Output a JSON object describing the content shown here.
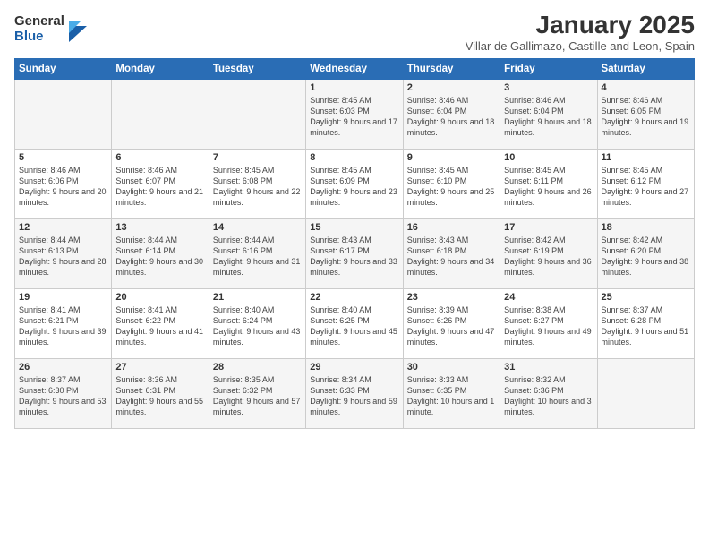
{
  "logo": {
    "general": "General",
    "blue": "Blue"
  },
  "title": "January 2025",
  "subtitle": "Villar de Gallimazo, Castille and Leon, Spain",
  "headers": [
    "Sunday",
    "Monday",
    "Tuesday",
    "Wednesday",
    "Thursday",
    "Friday",
    "Saturday"
  ],
  "weeks": [
    [
      {
        "day": "",
        "info": ""
      },
      {
        "day": "",
        "info": ""
      },
      {
        "day": "",
        "info": ""
      },
      {
        "day": "1",
        "info": "Sunrise: 8:45 AM\nSunset: 6:03 PM\nDaylight: 9 hours and 17 minutes."
      },
      {
        "day": "2",
        "info": "Sunrise: 8:46 AM\nSunset: 6:04 PM\nDaylight: 9 hours and 18 minutes."
      },
      {
        "day": "3",
        "info": "Sunrise: 8:46 AM\nSunset: 6:04 PM\nDaylight: 9 hours and 18 minutes."
      },
      {
        "day": "4",
        "info": "Sunrise: 8:46 AM\nSunset: 6:05 PM\nDaylight: 9 hours and 19 minutes."
      }
    ],
    [
      {
        "day": "5",
        "info": "Sunrise: 8:46 AM\nSunset: 6:06 PM\nDaylight: 9 hours and 20 minutes."
      },
      {
        "day": "6",
        "info": "Sunrise: 8:46 AM\nSunset: 6:07 PM\nDaylight: 9 hours and 21 minutes."
      },
      {
        "day": "7",
        "info": "Sunrise: 8:45 AM\nSunset: 6:08 PM\nDaylight: 9 hours and 22 minutes."
      },
      {
        "day": "8",
        "info": "Sunrise: 8:45 AM\nSunset: 6:09 PM\nDaylight: 9 hours and 23 minutes."
      },
      {
        "day": "9",
        "info": "Sunrise: 8:45 AM\nSunset: 6:10 PM\nDaylight: 9 hours and 25 minutes."
      },
      {
        "day": "10",
        "info": "Sunrise: 8:45 AM\nSunset: 6:11 PM\nDaylight: 9 hours and 26 minutes."
      },
      {
        "day": "11",
        "info": "Sunrise: 8:45 AM\nSunset: 6:12 PM\nDaylight: 9 hours and 27 minutes."
      }
    ],
    [
      {
        "day": "12",
        "info": "Sunrise: 8:44 AM\nSunset: 6:13 PM\nDaylight: 9 hours and 28 minutes."
      },
      {
        "day": "13",
        "info": "Sunrise: 8:44 AM\nSunset: 6:14 PM\nDaylight: 9 hours and 30 minutes."
      },
      {
        "day": "14",
        "info": "Sunrise: 8:44 AM\nSunset: 6:16 PM\nDaylight: 9 hours and 31 minutes."
      },
      {
        "day": "15",
        "info": "Sunrise: 8:43 AM\nSunset: 6:17 PM\nDaylight: 9 hours and 33 minutes."
      },
      {
        "day": "16",
        "info": "Sunrise: 8:43 AM\nSunset: 6:18 PM\nDaylight: 9 hours and 34 minutes."
      },
      {
        "day": "17",
        "info": "Sunrise: 8:42 AM\nSunset: 6:19 PM\nDaylight: 9 hours and 36 minutes."
      },
      {
        "day": "18",
        "info": "Sunrise: 8:42 AM\nSunset: 6:20 PM\nDaylight: 9 hours and 38 minutes."
      }
    ],
    [
      {
        "day": "19",
        "info": "Sunrise: 8:41 AM\nSunset: 6:21 PM\nDaylight: 9 hours and 39 minutes."
      },
      {
        "day": "20",
        "info": "Sunrise: 8:41 AM\nSunset: 6:22 PM\nDaylight: 9 hours and 41 minutes."
      },
      {
        "day": "21",
        "info": "Sunrise: 8:40 AM\nSunset: 6:24 PM\nDaylight: 9 hours and 43 minutes."
      },
      {
        "day": "22",
        "info": "Sunrise: 8:40 AM\nSunset: 6:25 PM\nDaylight: 9 hours and 45 minutes."
      },
      {
        "day": "23",
        "info": "Sunrise: 8:39 AM\nSunset: 6:26 PM\nDaylight: 9 hours and 47 minutes."
      },
      {
        "day": "24",
        "info": "Sunrise: 8:38 AM\nSunset: 6:27 PM\nDaylight: 9 hours and 49 minutes."
      },
      {
        "day": "25",
        "info": "Sunrise: 8:37 AM\nSunset: 6:28 PM\nDaylight: 9 hours and 51 minutes."
      }
    ],
    [
      {
        "day": "26",
        "info": "Sunrise: 8:37 AM\nSunset: 6:30 PM\nDaylight: 9 hours and 53 minutes."
      },
      {
        "day": "27",
        "info": "Sunrise: 8:36 AM\nSunset: 6:31 PM\nDaylight: 9 hours and 55 minutes."
      },
      {
        "day": "28",
        "info": "Sunrise: 8:35 AM\nSunset: 6:32 PM\nDaylight: 9 hours and 57 minutes."
      },
      {
        "day": "29",
        "info": "Sunrise: 8:34 AM\nSunset: 6:33 PM\nDaylight: 9 hours and 59 minutes."
      },
      {
        "day": "30",
        "info": "Sunrise: 8:33 AM\nSunset: 6:35 PM\nDaylight: 10 hours and 1 minute."
      },
      {
        "day": "31",
        "info": "Sunrise: 8:32 AM\nSunset: 6:36 PM\nDaylight: 10 hours and 3 minutes."
      },
      {
        "day": "",
        "info": ""
      }
    ]
  ]
}
